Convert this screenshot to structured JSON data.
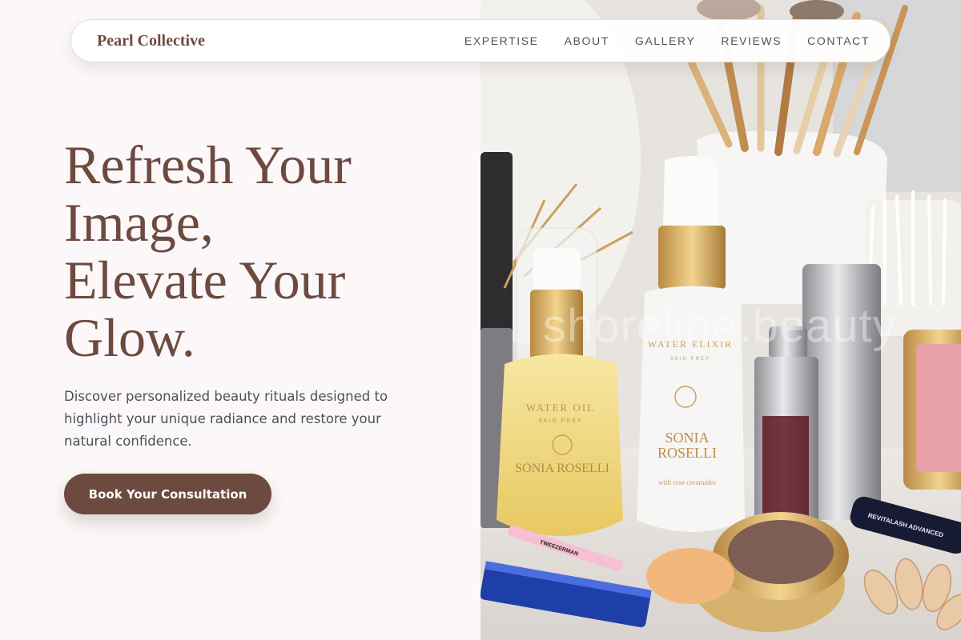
{
  "nav": {
    "brand": "Pearl Collective",
    "links": [
      "EXPERTISE",
      "ABOUT",
      "GALLERY",
      "REVIEWS",
      "CONTACT"
    ]
  },
  "hero": {
    "title_lines": [
      "Refresh Your",
      "Image,",
      "Elevate Your",
      "Glow."
    ],
    "description": "Discover personalized beauty rituals designed to highlight your unique radiance and restore your natural confidence.",
    "cta_label": "Book Your Consultation"
  },
  "photo": {
    "watermark": "shoreline.beauty",
    "labels": {
      "oil_bottle_name": "WATER OIL",
      "oil_bottle_sub": "SKIN PREP",
      "oil_brand": "SONIA ROSELLI",
      "elixir_name": "WATER ELIXIR",
      "elixir_sub": "SKIN PREP",
      "elixir_brand_1": "SONIA",
      "elixir_brand_2": "ROSELLI",
      "elixir_desc": "with rose ceramides",
      "tweezer": "TWEEZERMAN",
      "lash": "REVITALASH ADVANCED"
    }
  },
  "colors": {
    "brand": "#6d4a40",
    "background": "#fcf8f9",
    "nav_text": "#4f545c",
    "body_text": "#4a505a",
    "cta_text": "#ffffff"
  }
}
